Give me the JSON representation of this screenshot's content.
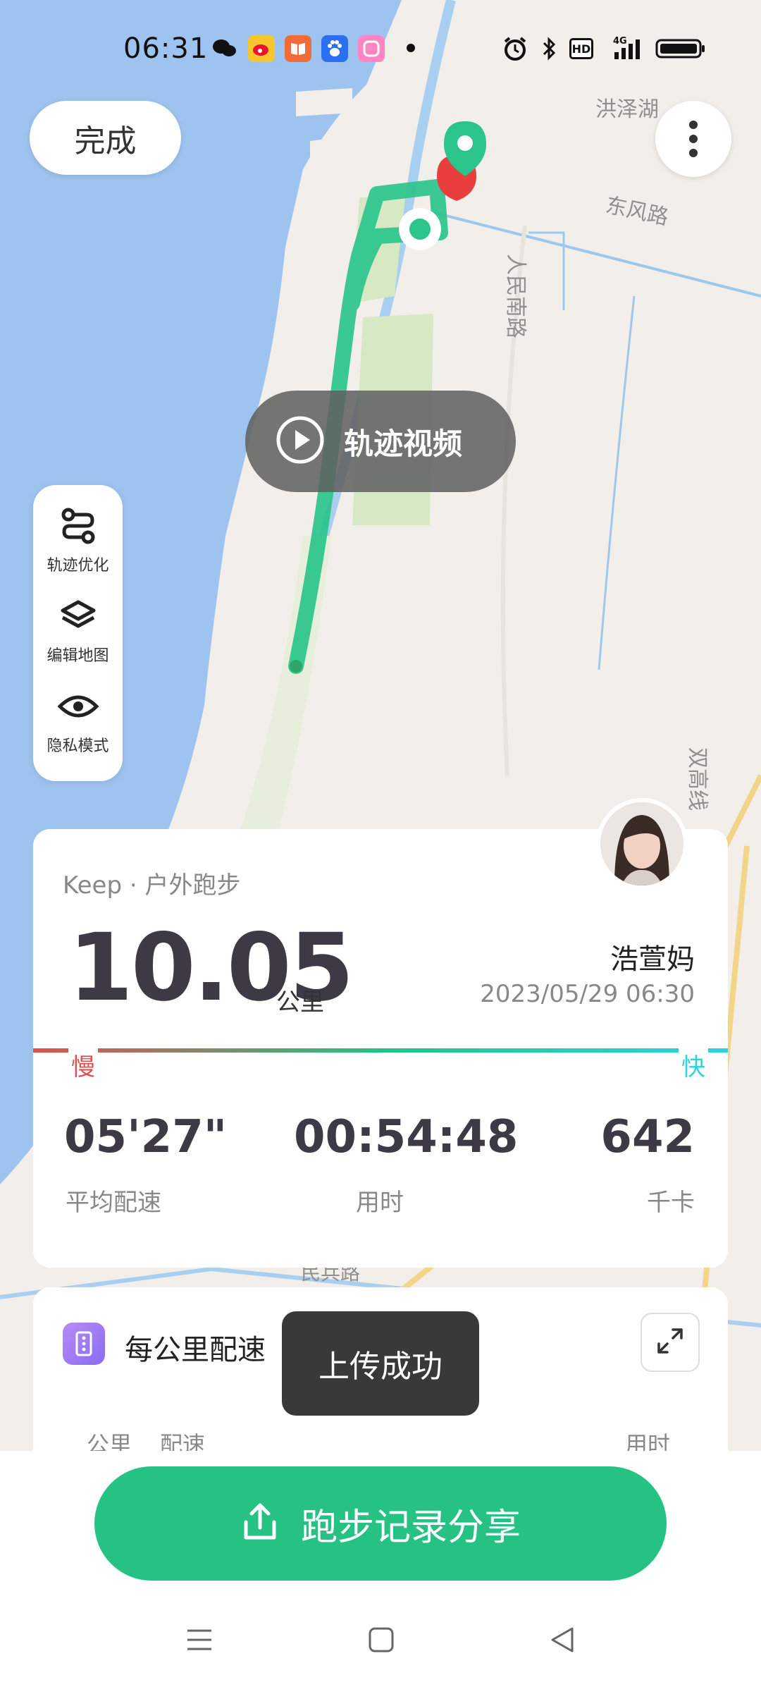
{
  "status_bar": {
    "time": "06:31",
    "icons": [
      "wechat-icon",
      "weibo-icon",
      "reader-icon",
      "baidu-icon",
      "app-icon",
      "alarm-icon",
      "bluetooth-icon",
      "hd-icon",
      "signal-icon",
      "battery-icon"
    ],
    "network": "4G",
    "hd": "HD"
  },
  "map": {
    "labels": {
      "road_1": "洪泽湖",
      "road_2": "东风路",
      "road_3": "人民南路",
      "road_4": "双高线",
      "road_5": "民兵路"
    },
    "route_color": "#2bc48a",
    "start_marker": "start-pin-icon",
    "end_marker": "end-pin-icon"
  },
  "top_bar": {
    "done_label": "完成",
    "more_icon": "more-vertical-icon"
  },
  "video": {
    "label": "轨迹视频",
    "icon": "play-icon"
  },
  "side_tools": [
    {
      "label": "轨迹优化",
      "icon": "route-icon"
    },
    {
      "label": "编辑地图",
      "icon": "layers-icon"
    },
    {
      "label": "隐私模式",
      "icon": "eye-icon"
    }
  ],
  "summary": {
    "source": "Keep · 户外跑步",
    "distance": "10.05",
    "distance_unit": "公里",
    "user_name": "浩萱妈",
    "datetime": "2023/05/29 06:30",
    "slow_label": "慢",
    "fast_label": "快",
    "slow_color": "#e05050",
    "fast_color": "#2fd3e0",
    "stats": [
      {
        "value": "05'27\"",
        "label": "平均配速"
      },
      {
        "value": "00:54:48",
        "label": "用时"
      },
      {
        "value": "642",
        "label": "千卡"
      }
    ]
  },
  "pace": {
    "title": "每公里配速",
    "col_km": "公里",
    "col_pace": "配速",
    "col_time": "用时"
  },
  "toast": "上传成功",
  "share": {
    "label": "跑步记录分享",
    "icon": "share-upload-icon",
    "color": "#26c283"
  },
  "nav": [
    "menu-icon",
    "home-icon",
    "back-icon"
  ]
}
